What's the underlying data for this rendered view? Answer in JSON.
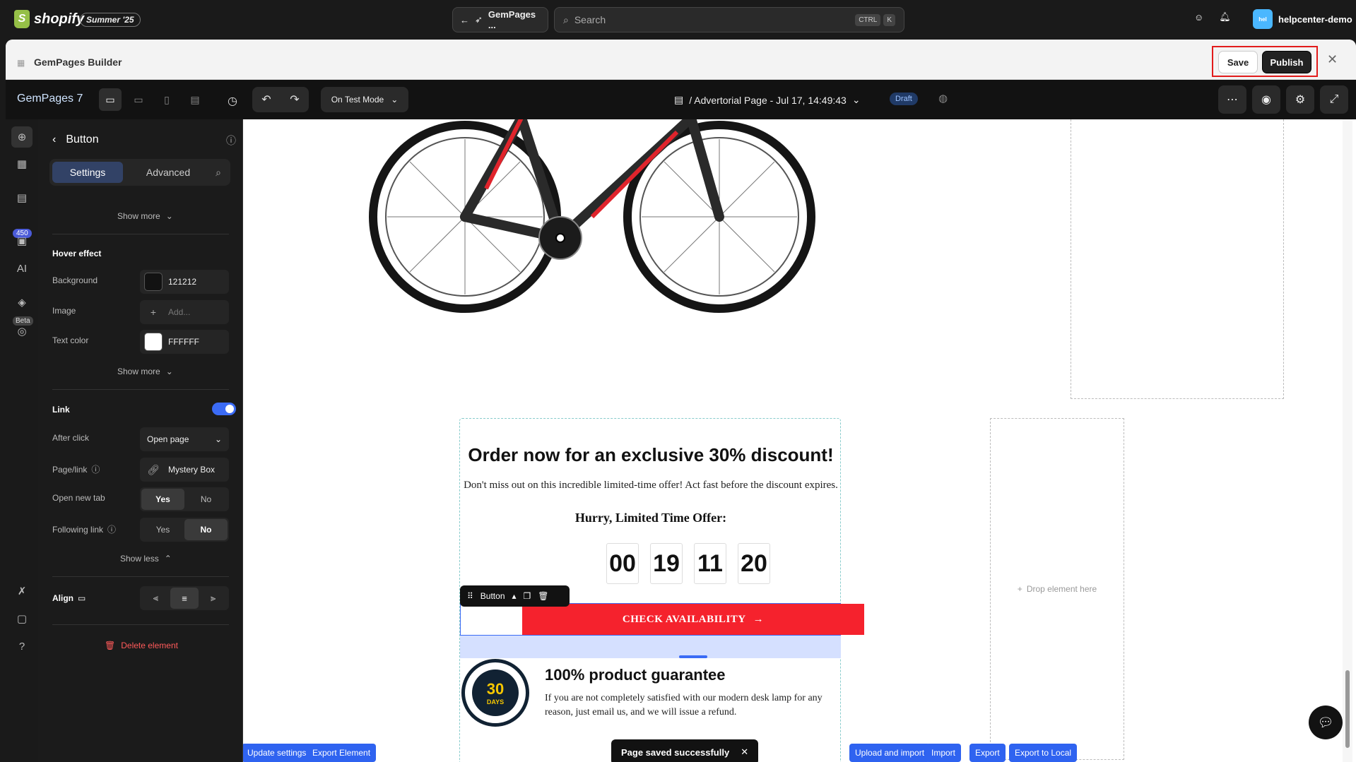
{
  "topbar": {
    "logo_text": "shopify",
    "edition": "Summer '25",
    "app_pill": "GemPages ...",
    "search_placeholder": "Search",
    "kbd1": "CTRL",
    "kbd2": "K",
    "username": "helpcenter-demo",
    "avatar_text": "hel"
  },
  "app_header": {
    "title": "GemPages Builder",
    "save_label": "Save",
    "publish_label": "Publish"
  },
  "builder_bar": {
    "app_name": "GemPages 7",
    "mode": "On Test Mode",
    "page_name": "/ Advertorial Page - Jul 17, 14:49:43",
    "status": "Draft"
  },
  "rail": {
    "count_badge": "450",
    "beta_badge": "Beta"
  },
  "panel": {
    "title": "Button",
    "tabs": {
      "settings": "Settings",
      "advanced": "Advanced"
    },
    "show_more_1": "Show more",
    "hover_section": "Hover effect",
    "background_label": "Background",
    "background_value": "121212",
    "image_label": "Image",
    "image_placeholder": "Add...",
    "text_color_label": "Text color",
    "text_color_value": "FFFFFF",
    "show_more_2": "Show more",
    "link_section": "Link",
    "after_click_label": "After click",
    "after_click_value": "Open page",
    "page_link_label": "Page/link",
    "page_link_value": "Mystery Box",
    "open_new_tab_label": "Open new tab",
    "following_link_label": "Following link",
    "yes": "Yes",
    "no": "No",
    "show_less": "Show less",
    "align_label": "Align",
    "delete_label": "Delete element"
  },
  "canvas": {
    "headline": "Order now for an exclusive 30% discount!",
    "subtext": "Don't miss out on this incredible limited-time offer! Act fast before the discount expires.",
    "hurry": "Hurry, Limited Time Offer:",
    "timer": [
      "00",
      "19",
      "11",
      "20"
    ],
    "button_tag": "Button",
    "cta_label": "CHECK AVAILABILITY",
    "badge_number": "30",
    "badge_days": "DAYS",
    "guarantee_title": "100% product guarantee",
    "guarantee_text": "If you are not completely satisfied with our modern desk lamp for any reason, just email us, and we will issue a refund.",
    "drop_here": "Drop element here",
    "toast": "Page saved successfully",
    "update_settings": "Update settings",
    "export_element": "Export Element",
    "upload_import": "Upload and import",
    "import": "Import",
    "export": "Export",
    "export_local": "Export to Local"
  },
  "colors": {
    "accent": "#3b6bf5",
    "cta": "#f5222d",
    "highlight": "#e21b1b"
  }
}
